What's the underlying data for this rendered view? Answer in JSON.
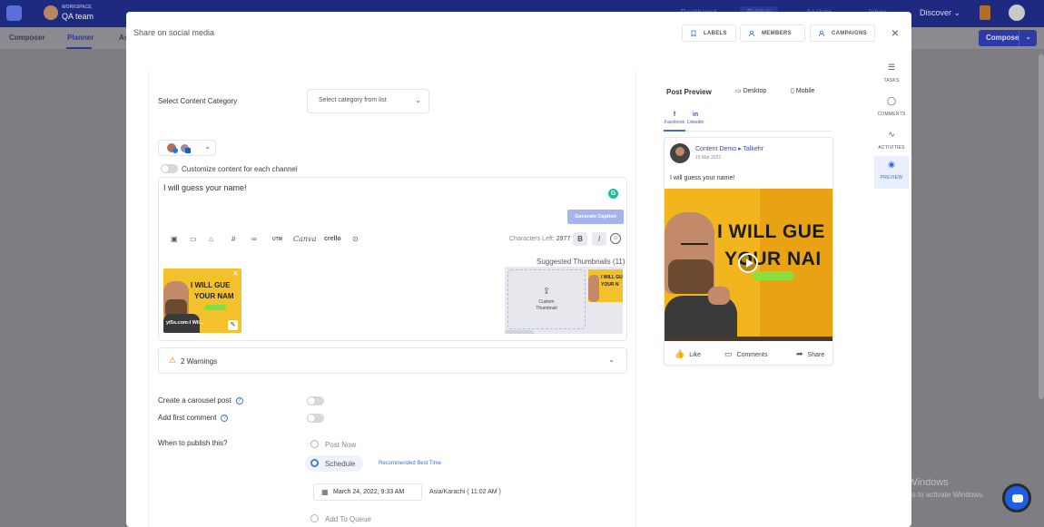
{
  "background": {
    "workspace_label": "WORKSPACE",
    "team_name": "QA team",
    "nav": [
      "Dashboard",
      "Publish",
      "Analyze",
      "Inbox",
      "Discover"
    ],
    "subtabs": [
      "Composer",
      "Planner",
      "As"
    ],
    "compose_button": "Compose"
  },
  "modal": {
    "title": "Share on social media",
    "header_buttons": {
      "labels": "LABELS",
      "members": "MEMBERS",
      "campaigns": "CAMPAIGNS"
    },
    "close": "×"
  },
  "rail": {
    "tasks": "TASKS",
    "comments": "COMMENTS",
    "activities": "ACTIVITIES",
    "preview": "PREVIEW"
  },
  "composer": {
    "category_label": "Select Content Category",
    "category_placeholder": "Select category from list",
    "customize_label": "Customize content for each channel",
    "text": "I will guess your name!",
    "generate_caption": "Generate Caption",
    "tools": {
      "utm": "UTM",
      "canva": "Canva",
      "crello": "crello"
    },
    "chars_left_label": "Characters Left:",
    "chars_left_value": "2977",
    "bold": "B",
    "italic": "I",
    "thumbnail_caption": "yt5s.com-I Wil...",
    "thumbnail_text_1": "I WILL GUE",
    "thumbnail_text_2": "YOUR NAM",
    "suggested_label": "Suggested Thumbnails (11)",
    "custom_thumbnail_1": "Custom",
    "custom_thumbnail_2": "Thumbnail",
    "suggested_text_1": "I WILL GU",
    "suggested_text_2": "YOUR N",
    "warnings": "2 Warnings",
    "carousel_label": "Create a carousel post",
    "first_comment_label": "Add first comment",
    "publish_label": "When to publish this?",
    "post_now": "Post Now",
    "schedule": "Schedule",
    "best_time": "Recommended Best Time",
    "date_value": "March 24, 2022, 9:33 AM",
    "timezone": "Asia/Karachi ( 11:02 AM )",
    "add_queue": "Add To Queue"
  },
  "preview": {
    "title": "Post Preview",
    "desktop": "Desktop",
    "mobile": "Mobile",
    "tabs": [
      {
        "icon": "f",
        "label": "Facebook"
      },
      {
        "icon": "in",
        "label": "Linkedin"
      }
    ],
    "author": "Content Demo",
    "page": "Talkehr",
    "date": "15 Mar 2022",
    "text": "I will guess your name!",
    "video_text_1": "I WILL GUE",
    "video_text_2": "YOUR NAI",
    "like": "Like",
    "comments": "Comments",
    "share": "Share"
  },
  "watermark": {
    "line1": "Activate Windows",
    "line2": "Go to Settings to activate Windows."
  }
}
